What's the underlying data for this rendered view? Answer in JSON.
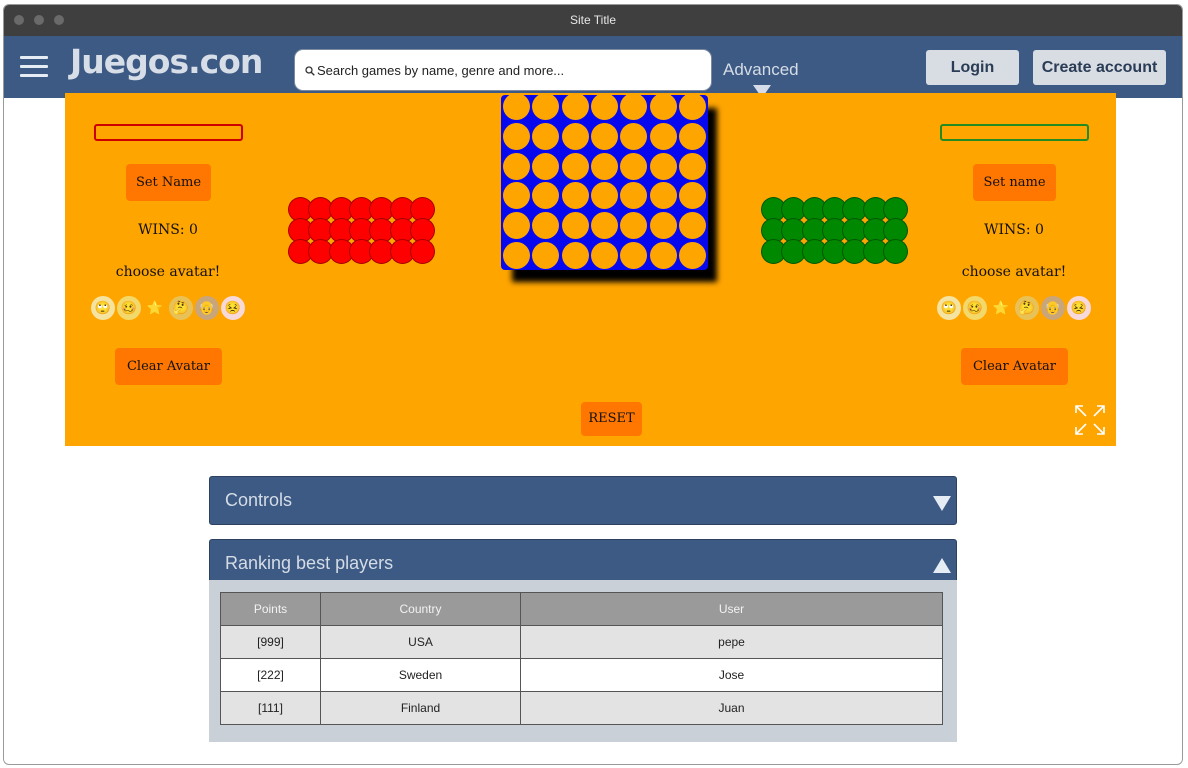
{
  "window": {
    "title": "Site Title"
  },
  "header": {
    "logo": "Juegos.con",
    "search_placeholder": "Search games by name, genre and more...",
    "advanced_label": "Advanced",
    "login_label": "Login",
    "create_account_label": "Create account"
  },
  "game": {
    "player1": {
      "set_name_label": "Set Name",
      "wins_text": "WINS: 0",
      "choose_avatar_text": "choose avatar!",
      "clear_avatar_label": "Clear Avatar",
      "chip_color": "#ff0000",
      "box_color": "#cc0000"
    },
    "player2": {
      "set_name_label": "Set name",
      "wins_text": "WINS: 0",
      "choose_avatar_text": "choose avatar!",
      "clear_avatar_label": "Clear Avatar",
      "chip_color": "#008800",
      "box_color": "#228b22"
    },
    "avatars": [
      "🙄",
      "🥴",
      "⭐",
      "🤔",
      "👴",
      "😣"
    ],
    "reset_label": "RESET",
    "board": {
      "rows": 6,
      "columns": 7,
      "color": "#0808ee",
      "hole_color": "#ffa500"
    },
    "chips_per_player": 21
  },
  "controls": {
    "title": "Controls"
  },
  "ranking": {
    "title": "Ranking best players",
    "columns": [
      "Points",
      "Country",
      "User"
    ],
    "rows": [
      [
        "[999]",
        "USA",
        "pepe"
      ],
      [
        "[222]",
        "Sweden",
        "Jose"
      ],
      [
        "[111]",
        "Finland",
        "Juan"
      ]
    ]
  },
  "colors": {
    "header": "#3c5a84",
    "game_bg": "#ffa500",
    "button": "#ff7600"
  }
}
